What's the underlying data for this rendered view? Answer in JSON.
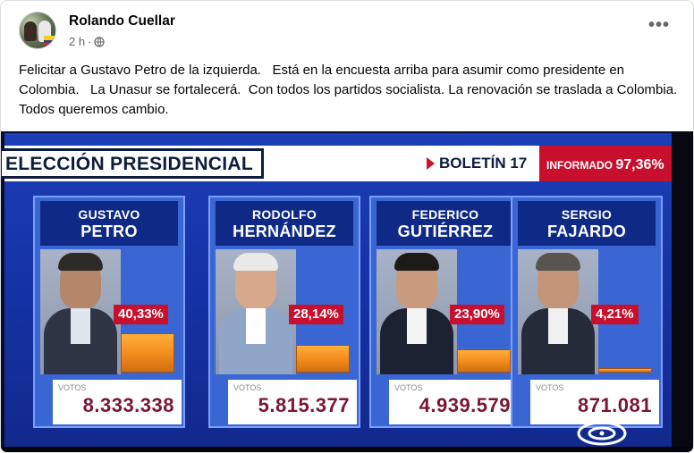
{
  "post": {
    "author": "Rolando Cuellar",
    "time": "2 h",
    "separator": "·",
    "more_label": "•••",
    "text": "Felicitar a Gustavo Petro de la izquierda.   Está en la encuesta arriba para asumir como presidente en Colombia.   La Unasur se fortalecerá.  Con todos los partidos socialista. La renovación se traslada a Colombia.   Todos queremos cambio."
  },
  "broadcast": {
    "title": "ELECCIÓN PRESIDENCIAL",
    "boletin": "BOLETÍN 17",
    "informado_label": "INFORMADO",
    "informado_value": "97,36%",
    "votes_label": "VOTOS",
    "candidates": [
      {
        "first": "GUSTAVO",
        "last": "PETRO",
        "pct": "40,33%",
        "votes": "8.333.338",
        "share": 40.33
      },
      {
        "first": "RODOLFO",
        "last": "HERNÁNDEZ",
        "pct": "28,14%",
        "votes": "5.815.377",
        "share": 28.14
      },
      {
        "first": "FEDERICO",
        "last": "GUTIÉRREZ",
        "pct": "23,90%",
        "votes": "4.939.579",
        "share": 23.9
      },
      {
        "first": "SERGIO",
        "last": "FAJARDO",
        "pct": "4,21%",
        "votes": "871.081",
        "share": 4.21
      }
    ]
  },
  "colors": {
    "accent_red": "#c8102e",
    "bar_orange": "#f08a1c",
    "panel_blue": "#1b3fb8"
  }
}
